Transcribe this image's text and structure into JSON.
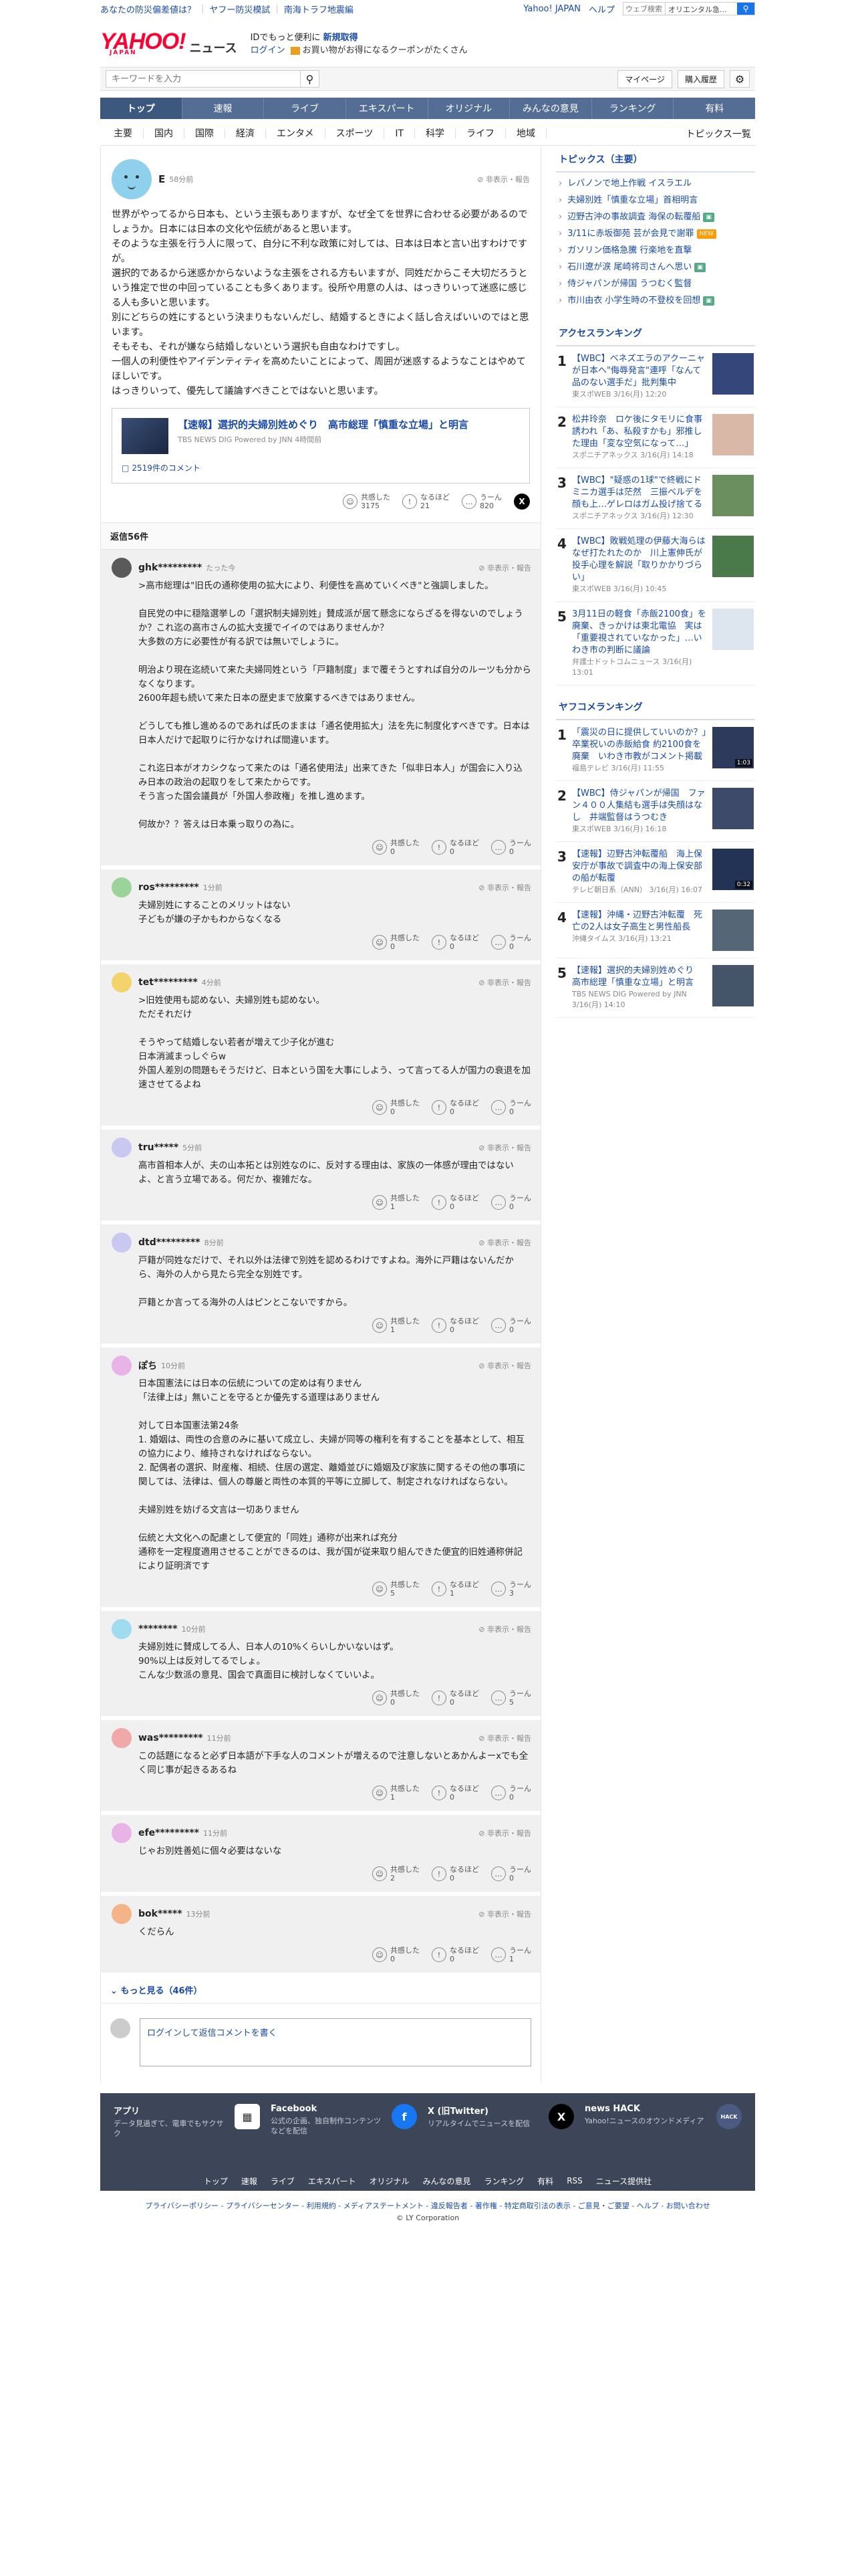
{
  "topbar": {
    "link1": "あなたの防災偏差値は？",
    "link2": "ヤフー防災模試",
    "link3": "南海トラフ地震編",
    "yj": "Yahoo! JAPAN",
    "help": "ヘルプ",
    "search_placeholder": "ウェブ検索",
    "search_keyword": "オリエンタル急..."
  },
  "header": {
    "logo": "YAHOO!",
    "logo_japan": "JAPAN",
    "logo_news": "ニュース",
    "promo_line1": "IDでもっと便利に",
    "promo_bold": "新規取得",
    "login": "ログイン",
    "coupon": "お買い物がお得になるクーポンがたくさん"
  },
  "search": {
    "placeholder": "キーワードを入力",
    "mypage": "マイページ",
    "history": "購入履歴"
  },
  "nav1": [
    "トップ",
    "速報",
    "ライブ",
    "エキスパート",
    "オリジナル",
    "みんなの意見",
    "ランキング",
    "有料"
  ],
  "nav2": [
    "主要",
    "国内",
    "国際",
    "経済",
    "エンタメ",
    "スポーツ",
    "IT",
    "科学",
    "ライフ",
    "地域"
  ],
  "nav2_topics": "トピックス一覧",
  "post": {
    "user": "E",
    "time": "58分前",
    "report": "非表示・報告",
    "body": "世界がやってるから日本も、という主張もありますが、なぜ全てを世界に合わせる必要があるのでしょうか。日本には日本の文化や伝統があると思います。\nそのような主張を行う人に限って、自分に不利な政策に対しては、日本は日本と言い出すわけですが。\n選択的であるから迷惑かからないような主張をされる方もいますが、同姓だからこそ大切だろうという推定で世の中回っていることも多くあります。役所や用意の人は、はっきりいって迷惑に感じる人も多いと思います。\n別にどちらの姓にするという決まりもないんだし、結婚するときによく話し合えばいいのではと思います。\nそもそも、それが嫌なら結婚しないという選択も自由なわけですし。\n一個人の利便性やアイデンティティを高めたいことによって、周囲が迷惑するようなことはやめてほしいです。\nはっきりいって、優先して議論すべきことではないと思います。",
    "link_title": "【速報】選択的夫婦別姓めぐり　高市総理「慎重な立場」と明言",
    "link_source": "TBS NEWS DIG Powered by JNN 4時間前",
    "link_comments": "2519件のコメント",
    "react1_label": "共感した",
    "react1": "3175",
    "react2_label": "なるほど",
    "react2": "21",
    "react3_label": "うーん",
    "react3": "820"
  },
  "reply_count": "返信56件",
  "replies": [
    {
      "user": "ghk*********",
      "time": "たった今",
      "body": ">高市総理は\"旧氏の通称使用の拡大により、利便性を高めていくべき\"と強調しました。\n\n自民党の中に穏陰選挙しの「選択制夫婦別姓」賛成派が居て懸念にならざるを得ないのでしょうか？これ迄の高市さんの拡大支援でイイのではありませんか？\n大多数の方に必要性が有る訳では無いでしょうに。\n\n明治より現在迄続いて来た夫婦同姓という「戸籍制度」まで覆そうとすれば自分のルーツも分からなくなります。\n2600年超も続いて来た日本の歴史まで放棄するべきではありません。\n\nどうしても推し進めるのであれば氏のままは「通名使用拡大」法を先に制度化すべきです。日本は日本人だけで起取りに行かなければ間違います。\n\nこれ迄日本がオカシクなって来たのは「通名使用法」出来てきた「似非日本人」が国会に入り込み日本の政治の起取りをして来たからです。\nそう言った国会議員が「外国人参政権」を推し進めます。\n\n何故か？？答えは日本乗っ取りの為に。",
      "r": [
        "0",
        "0",
        "0"
      ]
    },
    {
      "user": "ros*********",
      "time": "1分前",
      "body": "夫婦別姓にすることのメリットはない\n子どもが嫌の子かもわからなくなる",
      "r": [
        "0",
        "0",
        "0"
      ]
    },
    {
      "user": "tet*********",
      "time": "4分前",
      "body": ">旧姓使用も認めない、夫婦別姓も認めない。\nただそれだけ\n\nそうやって結婚しない若者が増えて少子化が進む\n日本消滅まっしぐらw\n外国人差別の問題もそうだけど、日本という国を大事にしよう、って言ってる人が国力の衰退を加速させてるよね",
      "r": [
        "0",
        "0",
        "0"
      ]
    },
    {
      "user": "tru*****",
      "time": "5分前",
      "body": "高市首相本人が、夫の山本拓とは別姓なのに、反対する理由は、家族の一体感が理由ではないよ、と言う立場である。何だか、複雑だな。",
      "r": [
        "1",
        "0",
        "0"
      ]
    },
    {
      "user": "dtd*********",
      "time": "8分前",
      "body": "戸籍が同姓なだけで、それ以外は法律で別姓を認めるわけですよね。海外に戸籍はないんだから、海外の人から見たら完全な別姓です。\n\n戸籍とか言ってる海外の人はピンとこないですから。",
      "r": [
        "1",
        "0",
        "0"
      ]
    },
    {
      "user": "ぽち",
      "time": "10分前",
      "body": "日本国憲法には日本の伝統についての定めは有りません\n「法律上は」無いことを守るとか優先する道理はありません\n\n対して日本国憲法第24条\n1. 婚姻は、両性の合意のみに基いて成立し、夫婦が同等の権利を有することを基本として、相互の協力により、維持されなければならない。\n2. 配偶者の選択、財産権、相続、住居の選定、離婚並びに婚姻及び家族に関するその他の事項に関しては、法律は、個人の尊厳と両性の本質的平等に立脚して、制定されなければならない。\n\n夫婦別姓を妨げる文言は一切ありません\n\n伝統と大文化への配慮として便宜的「同姓」通称が出来れば充分\n通称を一定程度適用させることができるのは、我が国が従来取り組んできた便宜的旧姓通称併記により証明済です",
      "r": [
        "5",
        "1",
        "3"
      ]
    },
    {
      "user": "********",
      "time": "10分前",
      "body": "夫婦別姓に賛成してる人、日本人の10%くらいしかいないはず。\n90%以上は反対してるでしょ。\nこんな少数派の意見、国会で真面目に検討しなくていいよ。",
      "r": [
        "0",
        "0",
        "5"
      ]
    },
    {
      "user": "was*********",
      "time": "11分前",
      "body": "この話題になると必ず日本語が下手な人のコメントが増えるので注意しないとあかんよーxでも全く同じ事が起きるあるね",
      "r": [
        "1",
        "0",
        "0"
      ]
    },
    {
      "user": "efe*********",
      "time": "11分前",
      "body": "じゃお別姓善処に個々必要はないな",
      "r": [
        "2",
        "0",
        "0"
      ]
    },
    {
      "user": "bok*****",
      "time": "13分前",
      "body": "くだらん",
      "r": [
        "0",
        "0",
        "1"
      ]
    }
  ],
  "more_replies": "もっと見る（46件）",
  "composer_placeholder": "ログインして返信コメントを書く",
  "sidebar": {
    "topics_title": "トピックス（主要）",
    "topics": [
      {
        "t": "レバノンで地上作戦 イスラエル",
        "badge": ""
      },
      {
        "t": "夫婦別姓「慎重な立場」首相明言",
        "badge": ""
      },
      {
        "t": "辺野古沖の事故調査 海保の転覆船",
        "badge": "img"
      },
      {
        "t": "3/11に赤坂御苑 芸が会見で謝罪",
        "badge": "new"
      },
      {
        "t": "ガソリン価格急騰 行楽地を直撃",
        "badge": ""
      },
      {
        "t": "石川遼が涙 尾崎将司さんへ思い",
        "badge": "img"
      },
      {
        "t": "侍ジャパンが帰国 うつむく監督",
        "badge": ""
      },
      {
        "t": "市川由衣 小学生時の不登校を回想",
        "badge": "img"
      }
    ],
    "access_title": "アクセスランキング",
    "access": [
      {
        "n": "1",
        "t": "【WBC】ベネズエラのアクーニャが日本へ\"侮辱発言\"連呼「なんて品のない選手だ」批判集中",
        "s": "東スポWEB 3/16(月) 12:20"
      },
      {
        "n": "2",
        "t": "松井玲奈　ロケ後にタモリに食事誘われ「あ、私殺すかも」邪推した理由「変な空気になって…」",
        "s": "スポニチアネックス 3/16(月) 14:18"
      },
      {
        "n": "3",
        "t": "【WBC】\"疑惑の1球\"で終戦にドミニカ選手は茫然　三振ベルデを顔も上…ゲレロはガム投げ捨てる",
        "s": "スポニチアネックス 3/16(月) 12:30"
      },
      {
        "n": "4",
        "t": "【WBC】敗戦処理の伊藤大海らはなぜ打たれたのか　川上憲伸氏が投手心理を解説「取りかかりづらい」",
        "s": "東スポWEB 3/16(月) 10:45"
      },
      {
        "n": "5",
        "t": "3月11日の軽食「赤飯2100食」を廃棄、きっかけは東北電協　実は「重要視されていなかった」…いわき市の判断に議論",
        "s": "弁護士ドットコムニュース 3/16(月) 13:01"
      }
    ],
    "comment_title": "ヤフコメランキング",
    "comment": [
      {
        "n": "1",
        "t": "「震災の日に提供していいのか？」卒業祝いの赤飯給食 約2100食を廃棄　いわき市教がコメント掲載",
        "s": "福島テレビ 3/16(月) 11:55",
        "v": "1:03"
      },
      {
        "n": "2",
        "t": "【WBC】侍ジャパンが帰国　ファン４００人集結も選手は失顔はなし　井端監督はうつむき",
        "s": "東スポWEB 3/16(月) 16:18",
        "v": ""
      },
      {
        "n": "3",
        "t": "【速報】辺野古沖転覆船　海上保安庁が事故で調査中の海上保安部の船が転覆",
        "s": "テレビ朝日系（ANN） 3/16(月) 16:07",
        "v": "0:32"
      },
      {
        "n": "4",
        "t": "【速報】沖縄・辺野古沖転覆　死亡の2人は女子高生と男性船長",
        "s": "沖縄タイムス 3/16(月) 13:21",
        "v": ""
      },
      {
        "n": "5",
        "t": "【速報】選択的夫婦別姓めぐり　高市総理「慎重な立場」と明言",
        "s": "TBS NEWS DIG Powered by JNN 3/16(月) 14:10",
        "v": ""
      }
    ]
  },
  "footer": {
    "apps": [
      {
        "t": "アプリ",
        "d": "データ見過ぎて、電車でもサクサク"
      },
      {
        "t": "Facebook",
        "d": "公式の企画、独自制作コンテンツなどを配信"
      },
      {
        "t": "X (旧Twitter)",
        "d": "リアルタイムでニュースを配信"
      },
      {
        "t": "news HACK",
        "d": "Yahoo!ニュースのオウンドメディア"
      }
    ],
    "links": [
      "トップ",
      "速報",
      "ライブ",
      "エキスパート",
      "オリジナル",
      "みんなの意見",
      "ランキング",
      "有料",
      "RSS",
      "ニュース提供社"
    ],
    "legal": "プライバシーポリシー - プライバシーセンター - 利用規約 - メディアステートメント - 違反報告者 - 著作権 - 特定商取引法の表示 - ご意見・ご要望 - ヘルプ - お問い合わせ",
    "copyright": "© LY Corporation"
  }
}
